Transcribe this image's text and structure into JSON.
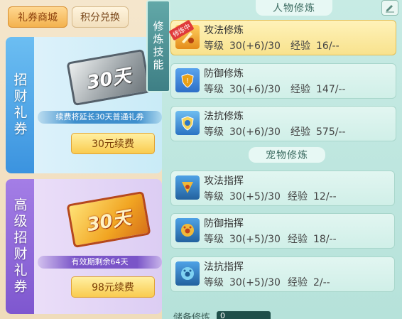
{
  "shop": {
    "tabs": [
      {
        "label": "礼券商城",
        "active": true
      },
      {
        "label": "积分兑换",
        "active": false
      }
    ],
    "cards": [
      {
        "title": "招财礼券",
        "ticket_text": "30天",
        "note": "续费将延长30天普通礼券",
        "button": "30元续费"
      },
      {
        "title": "高级招财礼券",
        "ticket_text": "30天",
        "note": "有效期剩余64天",
        "button": "98元续费"
      }
    ]
  },
  "panel": {
    "side_tab": "修炼技能",
    "sections": {
      "character": "人物修炼",
      "pet": "宠物修炼"
    },
    "level_label": "等级",
    "exp_label": "经验",
    "character_rows": [
      {
        "name": "攻法修炼",
        "level": "30(+6)/30",
        "exp": "16/--",
        "badge": "修炼中",
        "icon": "sword-claw-icon"
      },
      {
        "name": "防御修炼",
        "level": "30(+6)/30",
        "exp": "147/--",
        "icon": "shield-icon"
      },
      {
        "name": "法抗修炼",
        "level": "30(+6)/30",
        "exp": "575/--",
        "icon": "rune-shield-icon"
      }
    ],
    "pet_rows": [
      {
        "name": "攻法指挥",
        "level": "30(+5)/30",
        "exp": "12/--",
        "icon": "paw-attack-icon"
      },
      {
        "name": "防御指挥",
        "level": "30(+5)/30",
        "exp": "18/--",
        "icon": "paw-defense-icon"
      },
      {
        "name": "法抗指挥",
        "level": "30(+5)/30",
        "exp": "2/--",
        "icon": "paw-resist-icon"
      }
    ],
    "storage": {
      "label": "储备修炼",
      "value": "0"
    }
  },
  "colors": {
    "panel_bg": "#c7ebe4",
    "active_row": "#f8e28d",
    "button_gold": "#f9cb4f",
    "card1_accent": "#3b93df",
    "card2_accent": "#7e57cf"
  }
}
